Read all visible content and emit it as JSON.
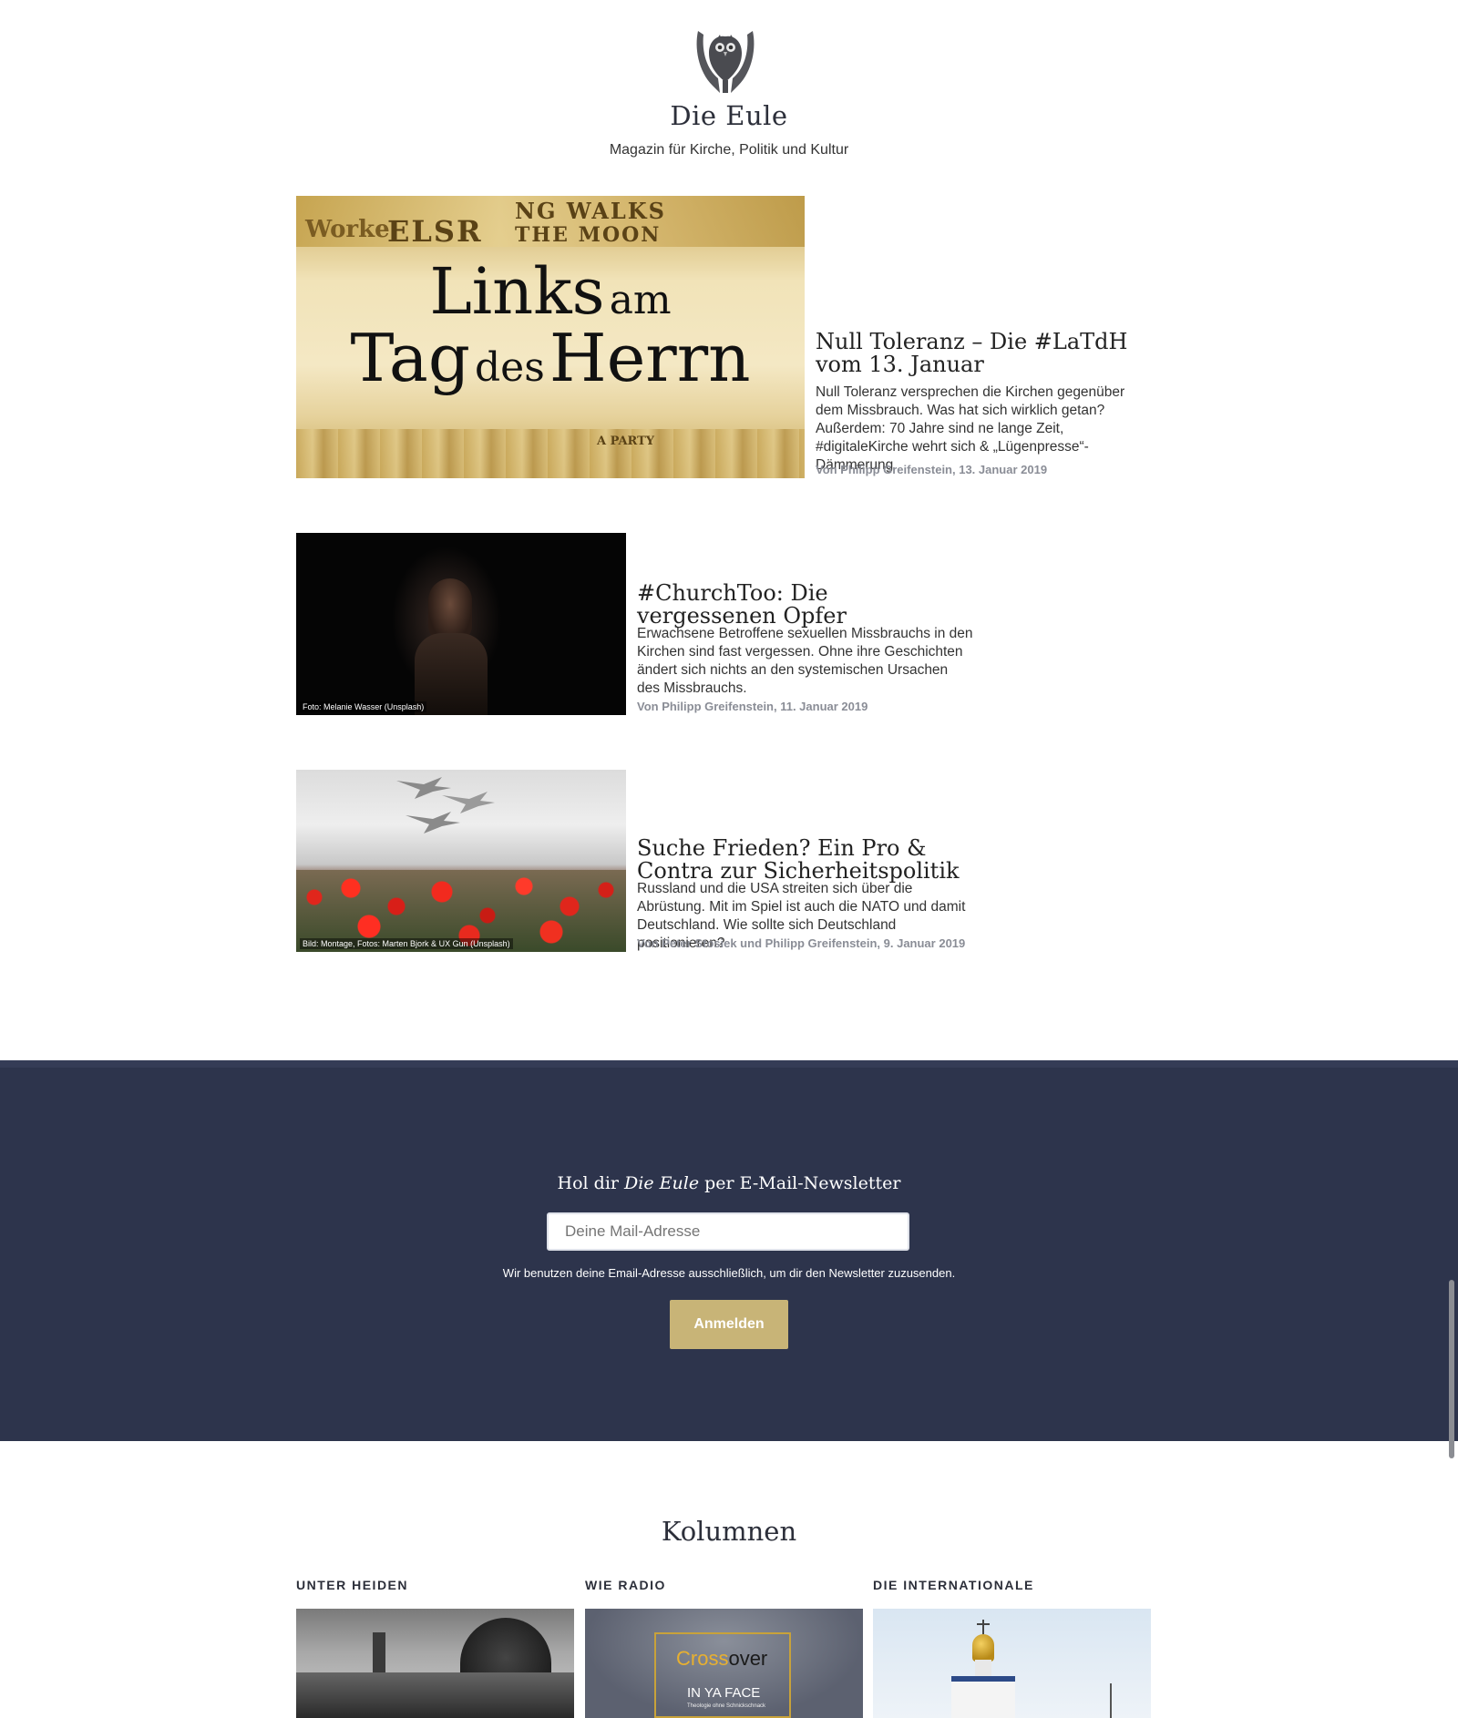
{
  "site": {
    "title": "Die Eule",
    "tagline": "Magazin für Kirche, Politik und Kultur"
  },
  "articles": [
    {
      "title": "Null Toleranz – Die #LaTdH vom 13. Januar",
      "excerpt": "Null Toleranz versprechen die Kirchen gegenüber dem Missbrauch. Was hat sich wirklich getan? Außerdem: 70 Jahre sind ne lange Zeit, #digitaleKirche wehrt sich & „Lügenpresse“-Dämmerung",
      "meta": "Von Philipp Greifenstein, 13. Januar 2019",
      "image": {
        "line1_big": "Links",
        "line1_small": "am",
        "line2_big1": "Tag",
        "line2_small": "des",
        "line2_big2": "Herrn",
        "headline_a": "NG WALKS",
        "headline_b": "THE MOON",
        "headline_c": "Worke",
        "headline_d": "ELSR",
        "headline_e": "A PARTY"
      }
    },
    {
      "title": "#ChurchToo: Die vergessenen Opfer",
      "excerpt": "Erwachsene Betroffene sexuellen Missbrauchs in den Kirchen sind fast vergessen. Ohne ihre Geschichten ändert sich nichts an den systemischen Ursachen des Missbrauchs.",
      "meta": "Von Philipp Greifenstein, 11. Januar 2019",
      "caption": "Foto: Melanie Wasser (Unsplash)"
    },
    {
      "title": "Suche Frieden? Ein Pro & Contra zur Sicherheitspolitik",
      "excerpt": "Russland und die USA streiten sich über die Abrüstung. Mit im Spiel ist auch die NATO und damit Deutschland. Wie sollte sich Deutschland positionieren?",
      "meta": "Von Peter Stosiek und Philipp Greifenstein, 9. Januar 2019",
      "caption": "Bild: Montage, Fotos: Marten Bjork & UX Gun (Unsplash)"
    }
  ],
  "newsletter": {
    "heading_pre": "Hol dir ",
    "heading_em": "Die Eule",
    "heading_post": " per E-Mail-Newsletter",
    "placeholder": "Deine Mail-Adresse",
    "note": "Wir benutzen deine Email-Adresse ausschließlich, um dir den Newsletter zuzusenden.",
    "button": "Anmelden"
  },
  "kolumnen": {
    "heading": "Kolumnen",
    "items": [
      {
        "label": "UNTER HEIDEN"
      },
      {
        "label": "WIE RADIO",
        "image_text_a": "Cross",
        "image_text_b": "over",
        "image_text_c": "IN YA FACE",
        "image_text_d": "Theologie ohne Schnickschnack"
      },
      {
        "label": "DIE INTERNATIONALE"
      }
    ]
  }
}
